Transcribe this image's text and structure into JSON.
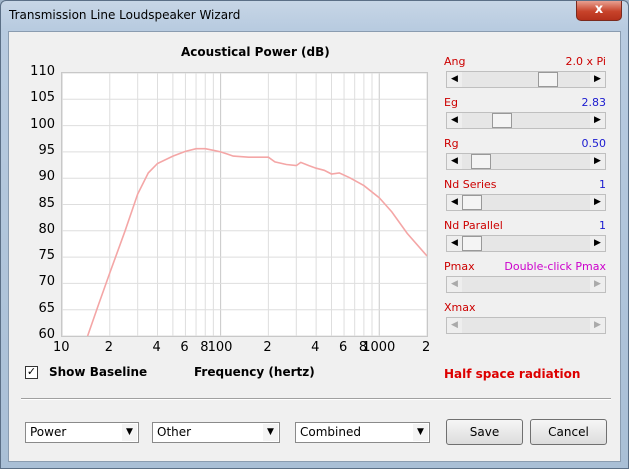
{
  "window": {
    "title": "Transmission Line Loudspeaker Wizard",
    "close_glyph": "x"
  },
  "chart_data": {
    "type": "line",
    "title": "Acoustical Power (dB)",
    "xlabel": "Frequency (hertz)",
    "ylabel": "",
    "x_scale": "log",
    "xlim": [
      10,
      2000
    ],
    "ylim": [
      60,
      110
    ],
    "grid": true,
    "yticks": [
      "110",
      "105",
      "100",
      "95",
      "90",
      "85",
      "80",
      "75",
      "70",
      "65",
      "60"
    ],
    "xticks": [
      {
        "v": 10,
        "label": "10"
      },
      {
        "v": 20,
        "label": "2"
      },
      {
        "v": 40,
        "label": "4"
      },
      {
        "v": 60,
        "label": "6"
      },
      {
        "v": 80,
        "label": "8"
      },
      {
        "v": 100,
        "label": "100"
      },
      {
        "v": 200,
        "label": "2"
      },
      {
        "v": 400,
        "label": "4"
      },
      {
        "v": 600,
        "label": "6"
      },
      {
        "v": 800,
        "label": "8"
      },
      {
        "v": 1000,
        "label": "1000"
      },
      {
        "v": 2000,
        "label": "2"
      }
    ],
    "series": [
      {
        "color": "#f4a6a6",
        "points": [
          [
            14.5,
            60
          ],
          [
            17,
            66
          ],
          [
            20,
            72
          ],
          [
            25,
            80
          ],
          [
            30,
            87
          ],
          [
            35,
            91
          ],
          [
            40,
            92.8
          ],
          [
            50,
            94.2
          ],
          [
            60,
            95.1
          ],
          [
            70,
            95.6
          ],
          [
            80,
            95.6
          ],
          [
            90,
            95.3
          ],
          [
            100,
            95.0
          ],
          [
            110,
            94.6
          ],
          [
            120,
            94.2
          ],
          [
            150,
            94.0
          ],
          [
            200,
            94.0
          ],
          [
            220,
            93.1
          ],
          [
            260,
            92.6
          ],
          [
            300,
            92.4
          ],
          [
            320,
            93.0
          ],
          [
            360,
            92.4
          ],
          [
            400,
            91.9
          ],
          [
            450,
            91.5
          ],
          [
            500,
            90.8
          ],
          [
            560,
            91.0
          ],
          [
            650,
            90.1
          ],
          [
            800,
            88.6
          ],
          [
            1000,
            86.3
          ],
          [
            1200,
            83.6
          ],
          [
            1500,
            79.5
          ],
          [
            2000,
            75.2
          ]
        ]
      }
    ]
  },
  "show_baseline": {
    "label": "Show Baseline",
    "checked": true,
    "check_glyph": "✓"
  },
  "controls": [
    {
      "label": "Ang",
      "value": "2.0 x Pi",
      "value_color": "#cc0000",
      "thumb": 0.7,
      "enabled": true
    },
    {
      "label": "Eg",
      "value": "2.83",
      "value_color": "#1a1ad0",
      "thumb": 0.28,
      "enabled": true
    },
    {
      "label": "Rg",
      "value": "0.50",
      "value_color": "#1a1ad0",
      "thumb": 0.08,
      "enabled": true
    },
    {
      "label": "Nd  Series",
      "value": "1",
      "value_color": "#1a1ad0",
      "thumb": 0.0,
      "enabled": true
    },
    {
      "label": "Nd  Parallel",
      "value": "1",
      "value_color": "#1a1ad0",
      "thumb": 0.0,
      "enabled": true
    },
    {
      "label": "Pmax",
      "value": "Double-click Pmax",
      "value_color": "#cc00cc",
      "thumb": null,
      "enabled": false
    },
    {
      "label": "Xmax",
      "value": "",
      "value_color": "#1a1ad0",
      "thumb": null,
      "enabled": false
    }
  ],
  "radiation_label": "Half space radiation",
  "selects": {
    "type": "Power",
    "other": "Other",
    "mode": "Combined"
  },
  "buttons": {
    "save": "Save",
    "cancel": "Cancel"
  },
  "scroll_glyphs": {
    "left": "◀",
    "right": "▶",
    "down": "▼"
  }
}
